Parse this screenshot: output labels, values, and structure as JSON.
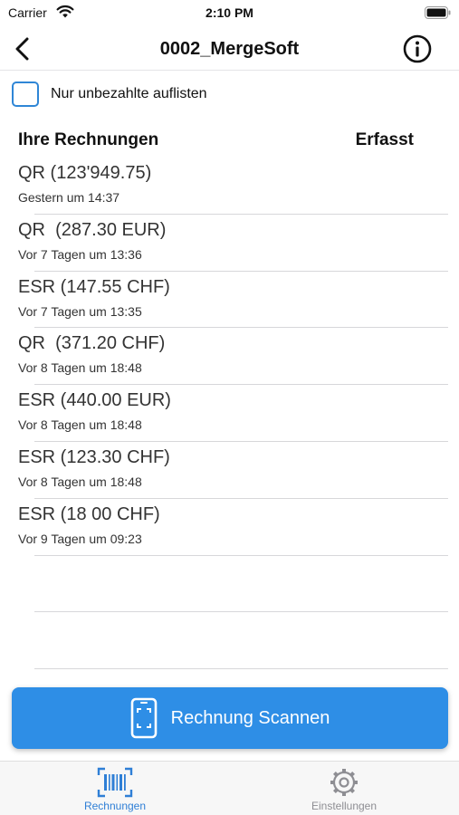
{
  "status_bar": {
    "carrier": "Carrier",
    "time": "2:10 PM"
  },
  "nav": {
    "title": "0002_MergeSoft"
  },
  "filter": {
    "label": "Nur unbezahlte auflisten",
    "checked": false
  },
  "list_header": {
    "left": "Ihre Rechnungen",
    "right": "Erfasst"
  },
  "invoices": [
    {
      "title": "QR (123'949.75)",
      "subtitle": "Gestern um 14:37"
    },
    {
      "title": "QR  (287.30 EUR)",
      "subtitle": "Vor 7 Tagen um 13:36"
    },
    {
      "title": "ESR (147.55 CHF)",
      "subtitle": "Vor 7 Tagen um 13:35"
    },
    {
      "title": "QR  (371.20 CHF)",
      "subtitle": "Vor 8 Tagen um 18:48"
    },
    {
      "title": "ESR (440.00 EUR)",
      "subtitle": "Vor 8 Tagen um 18:48"
    },
    {
      "title": "ESR (123.30 CHF)",
      "subtitle": "Vor 8 Tagen um 18:48"
    },
    {
      "title": "ESR (18 00 CHF)",
      "subtitle": "Vor 9 Tagen um 09:23"
    }
  ],
  "scan_button": {
    "label": "Rechnung Scannen"
  },
  "tabs": [
    {
      "label": "Rechnungen",
      "icon": "barcode-icon",
      "active": true
    },
    {
      "label": "Einstellungen",
      "icon": "gear-icon",
      "active": false
    }
  ],
  "colors": {
    "accent": "#2e8ee6",
    "tab_active": "#2f7fd6",
    "tab_inactive": "#8e8e93",
    "checkbox_border": "#2f86d6"
  }
}
